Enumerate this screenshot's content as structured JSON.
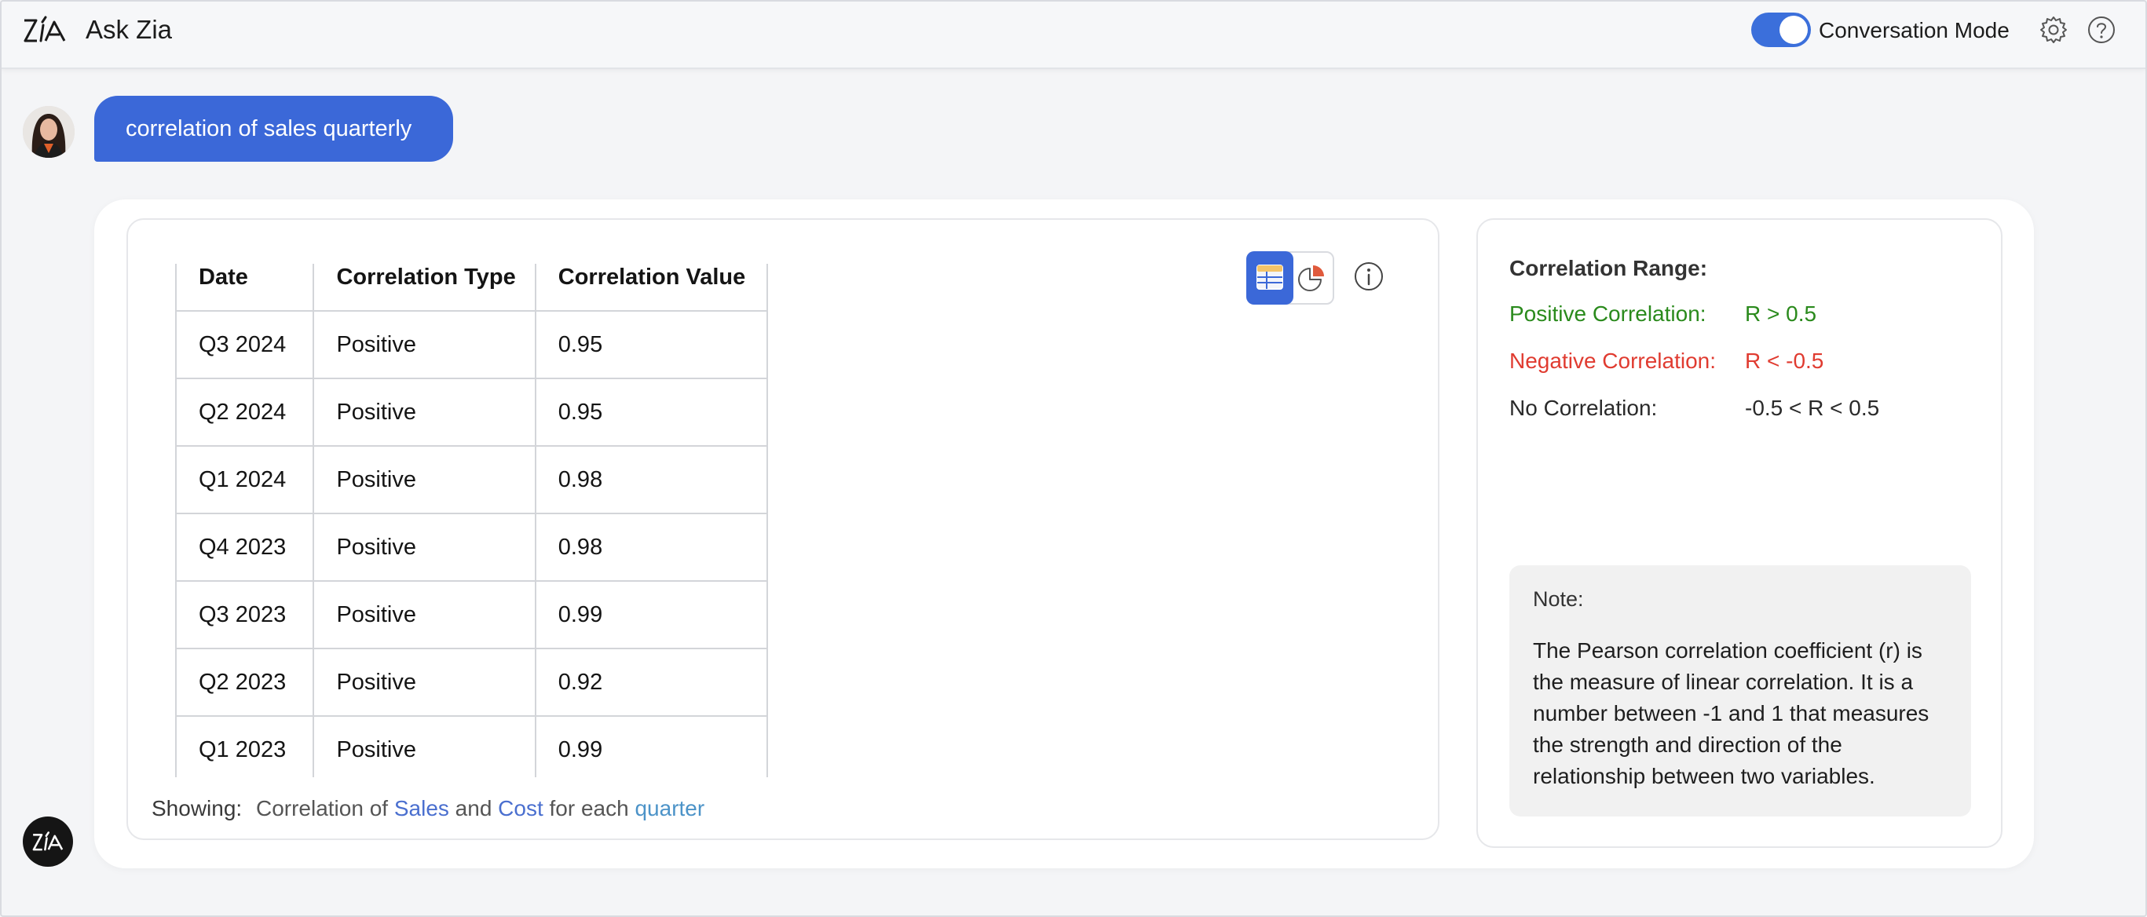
{
  "header": {
    "title": "Ask Zia",
    "mode_label": "Conversation Mode",
    "mode_on": true
  },
  "message": {
    "text": "correlation of sales quarterly"
  },
  "table": {
    "columns": [
      "Date",
      "Correlation Type",
      "Correlation Value"
    ],
    "rows": [
      [
        "Q3 2024",
        "Positive",
        "0.95"
      ],
      [
        "Q2 2024",
        "Positive",
        "0.95"
      ],
      [
        "Q1 2024",
        "Positive",
        "0.98"
      ],
      [
        "Q4 2023",
        "Positive",
        "0.98"
      ],
      [
        "Q3 2023",
        "Positive",
        "0.99"
      ],
      [
        "Q2 2023",
        "Positive",
        "0.92"
      ],
      [
        "Q1 2023",
        "Positive",
        "0.99"
      ]
    ]
  },
  "showing": {
    "label": "Showing:",
    "prefix": "Correlation of",
    "metric1": "Sales",
    "joiner": "and",
    "metric2": "Cost",
    "suffix": "for each",
    "dimension": "quarter"
  },
  "range": {
    "title": "Correlation Range:",
    "positive_label": "Positive Correlation:",
    "positive_value": "R > 0.5",
    "negative_label": "Negative Correlation:",
    "negative_value": "R < -0.5",
    "none_label": "No Correlation:",
    "none_value": "-0.5 < R < 0.5"
  },
  "note": {
    "title": "Note:",
    "text": "The Pearson correlation coefficient (r) is the measure of linear correlation. It is a number between -1 and 1 that measures the strength and direction of the relationship between two variables."
  },
  "colors": {
    "accent": "#3b68d8",
    "positive": "#2a8a1c",
    "negative": "#e03b30"
  },
  "icons": {
    "logo": "zia-logo-icon",
    "settings": "gear-icon",
    "help": "help-icon",
    "table_view": "table-view-icon",
    "chart_view": "pie-chart-icon",
    "info": "info-icon",
    "assistant": "zia-assistant-icon"
  }
}
